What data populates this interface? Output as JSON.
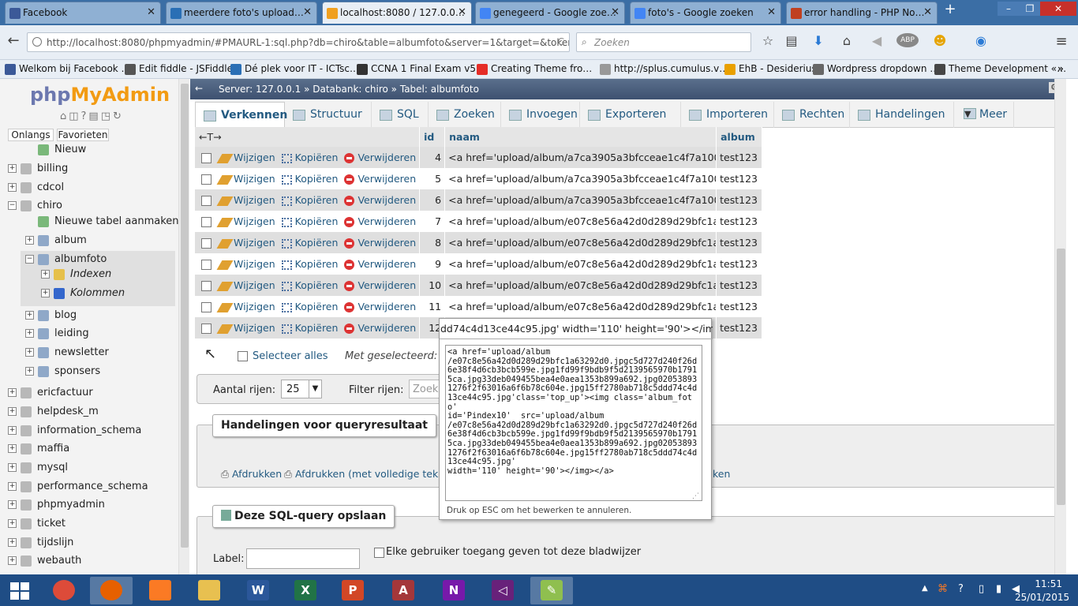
{
  "browser": {
    "tabs": [
      {
        "title": "Facebook",
        "color": "#3b5998"
      },
      {
        "title": "meerdere foto's upload…",
        "color": "#2a6fb5"
      },
      {
        "title": "localhost:8080 / 127.0.0…",
        "color": "#f0a020"
      },
      {
        "title": "genegeerd - Google zoe…",
        "color": "#4285f4"
      },
      {
        "title": "foto's - Google zoeken",
        "color": "#4285f4"
      },
      {
        "title": "error handling - PHP No…",
        "color": "#c04020"
      }
    ],
    "new_tab": "+",
    "window_controls": [
      "–",
      "❐",
      "✕"
    ],
    "url": "http://localhost:8080/phpmyadmin/#PMAURL-1:sql.php?db=chiro&table=albumfoto&server=1&target=&token=c13",
    "search_placeholder": "Zoeken",
    "nav_back": "←",
    "nav_reload": "C",
    "icons": [
      "star-icon",
      "bookmarks-list-icon",
      "download-icon",
      "home-icon"
    ],
    "bookmarks": [
      {
        "label": "Welkom bij Facebook …",
        "color": "#3b5998"
      },
      {
        "label": "Edit fiddle - JSFiddle",
        "color": "#555555"
      },
      {
        "label": "Dé plek voor IT - ICTsc…",
        "color": "#2a6fb5"
      },
      {
        "label": "CCNA 1 Final Exam v5…",
        "color": "#333333"
      },
      {
        "label": "Creating Theme fro…",
        "color": "#e52d27"
      },
      {
        "label": "http://splus.cumulus.v…",
        "color": "#999999"
      },
      {
        "label": "EhB - Desiderius",
        "color": "#e9a000"
      },
      {
        "label": "Wordpress dropdown …",
        "color": "#666666"
      },
      {
        "label": "Theme Development «…",
        "color": "#464646"
      }
    ],
    "bookmarks_more": "»"
  },
  "pma": {
    "logo_php": "php",
    "logo_myadmin": "MyAdmin",
    "tab_recent": "Onlangs",
    "tab_favorites": "Favorieten",
    "tree": [
      {
        "label": "Nieuw",
        "level": 1,
        "type": "new"
      },
      {
        "label": "billing",
        "level": 0
      },
      {
        "label": "cdcol",
        "level": 0
      },
      {
        "label": "chiro",
        "level": 0,
        "expanded": true
      },
      {
        "label": "Nieuwe tabel aanmaken",
        "level": 1,
        "type": "new"
      },
      {
        "label": "album",
        "level": 1,
        "type": "table"
      },
      {
        "label": "albumfoto",
        "level": 1,
        "type": "table",
        "expanded": true,
        "selected": true
      },
      {
        "label": "Indexen",
        "level": 2,
        "type": "index"
      },
      {
        "label": "Kolommen",
        "level": 2,
        "type": "columns"
      },
      {
        "label": "blog",
        "level": 1,
        "type": "table"
      },
      {
        "label": "leiding",
        "level": 1,
        "type": "table"
      },
      {
        "label": "newsletter",
        "level": 1,
        "type": "table"
      },
      {
        "label": "sponsers",
        "level": 1,
        "type": "table"
      },
      {
        "label": "ericfactuur",
        "level": 0
      },
      {
        "label": "helpdesk_m",
        "level": 0
      },
      {
        "label": "information_schema",
        "level": 0
      },
      {
        "label": "maffia",
        "level": 0
      },
      {
        "label": "mysql",
        "level": 0
      },
      {
        "label": "performance_schema",
        "level": 0
      },
      {
        "label": "phpmyadmin",
        "level": 0
      },
      {
        "label": "ticket",
        "level": 0
      },
      {
        "label": "tijdslijn",
        "level": 0
      },
      {
        "label": "webauth",
        "level": 0
      }
    ],
    "breadcrumb": {
      "server": "Server: 127.0.0.1",
      "database": "Databank: chiro",
      "table": "Tabel: albumfoto",
      "sep": "»"
    },
    "tabs": [
      "Verkennen",
      "Structuur",
      "SQL",
      "Zoeken",
      "Invoegen",
      "Exporteren",
      "Importeren",
      "Rechten",
      "Handelingen",
      "Meer"
    ],
    "columns": {
      "arrows": "←T→",
      "id": "id",
      "naam": "naam",
      "album": "album"
    },
    "actions": {
      "edit": "Wijzigen",
      "copy": "Kopiëren",
      "delete": "Verwijderen"
    },
    "rows": [
      {
        "id": "4",
        "naam": "<a href='upload/album/a7ca3905a3bfcceae1c4f7a10012…",
        "album": "test123"
      },
      {
        "id": "5",
        "naam": "<a href='upload/album/a7ca3905a3bfcceae1c4f7a10012…",
        "album": "test123"
      },
      {
        "id": "6",
        "naam": "<a href='upload/album/a7ca3905a3bfcceae1c4f7a10012…",
        "album": "test123"
      },
      {
        "id": "7",
        "naam": "<a href='upload/album/e07c8e56a42d0d289d29bfc1a632…",
        "album": "test123"
      },
      {
        "id": "8",
        "naam": "<a href='upload/album/e07c8e56a42d0d289d29bfc1a632…",
        "album": "test123"
      },
      {
        "id": "9",
        "naam": "<a href='upload/album/e07c8e56a42d0d289d29bfc1a632…",
        "album": "test123"
      },
      {
        "id": "10",
        "naam": "<a href='upload/album/e07c8e56a42d0d289d29bfc1a632…",
        "album": "test123"
      },
      {
        "id": "11",
        "naam": "<a href='upload/album/e07c8e56a42d0d289d29bfc1a632…",
        "album": "test123"
      },
      {
        "id": "12",
        "naam": "",
        "album": "test123"
      }
    ],
    "select_all": "Selecteer alles",
    "with_selected": "Met geselecteerd:",
    "rows_label": "Aantal rijen:",
    "rows_value": "25",
    "filter_label": "Filter rijen:",
    "filter_placeholder": "Zoek in",
    "query_ops_title": "Handelingen voor queryresultaat",
    "print": "Afdrukken",
    "print_full": "Afdrukken (met volledige tekste",
    "print_tail": "ken",
    "save_query_title": "Deze SQL-query opslaan",
    "label_label": "Label:",
    "label_value": "",
    "all_users": "Elke gebruiker toegang geven tot deze bladwijzer",
    "popup": {
      "line": "dd74c4d13ce44c95.jpg' width='110' height='90'></img></a>",
      "textarea": "<a href='upload/album\n/e07c8e56a42d0d289d29bfc1a63292d0.jpgc5d727d240f26d6e38f4d6cb3bcb599e.jpg1fd99f9bdb9f5d2139565970b17915ca.jpg33deb049455bea4e0aea1353b899a692.jpg020538931276f2f63016a6f6b78c604e.jpg15ff2780ab718c5ddd74c4d13ce44c95.jpg'class='top_up'><img class='album_foto'\nid='Pindex10'  src='upload/album\n/e07c8e56a42d0d289d29bfc1a63292d0.jpgc5d727d240f26d6e38f4d6cb3bcb599e.jpg1fd99f9bdb9f5d2139565970b17915ca.jpg33deb049455bea4e0aea1353b899a692.jpg020538931276f2f63016a6f6b78c604e.jpg15ff2780ab718c5ddd74c4d13ce44c95.jpg'\nwidth='110' height='90'></img></a>",
      "hint": "Druk op ESC om het bewerken te annuleren."
    }
  },
  "taskbar": {
    "apps": [
      {
        "name": "start-icon",
        "color": "#1f4d85"
      },
      {
        "name": "chrome-icon",
        "color": "#dd4b39"
      },
      {
        "name": "firefox-icon",
        "color": "#e66000"
      },
      {
        "name": "xampp-icon",
        "color": "#fb7a24"
      },
      {
        "name": "file-explorer-icon",
        "color": "#e8c050"
      },
      {
        "name": "word-icon",
        "color": "#2b579a",
        "letter": "W"
      },
      {
        "name": "excel-icon",
        "color": "#217346",
        "letter": "X"
      },
      {
        "name": "powerpoint-icon",
        "color": "#d24726",
        "letter": "P"
      },
      {
        "name": "access-icon",
        "color": "#a4373a",
        "letter": "A"
      },
      {
        "name": "onenote-icon",
        "color": "#7719aa",
        "letter": "N"
      },
      {
        "name": "visual-studio-icon",
        "color": "#68217a",
        "letter": "◁"
      },
      {
        "name": "notepadpp-icon",
        "color": "#8fbf4f",
        "letter": "✎"
      }
    ],
    "time": "11:51",
    "date": "25/01/2015",
    "tray_up": "▲"
  }
}
